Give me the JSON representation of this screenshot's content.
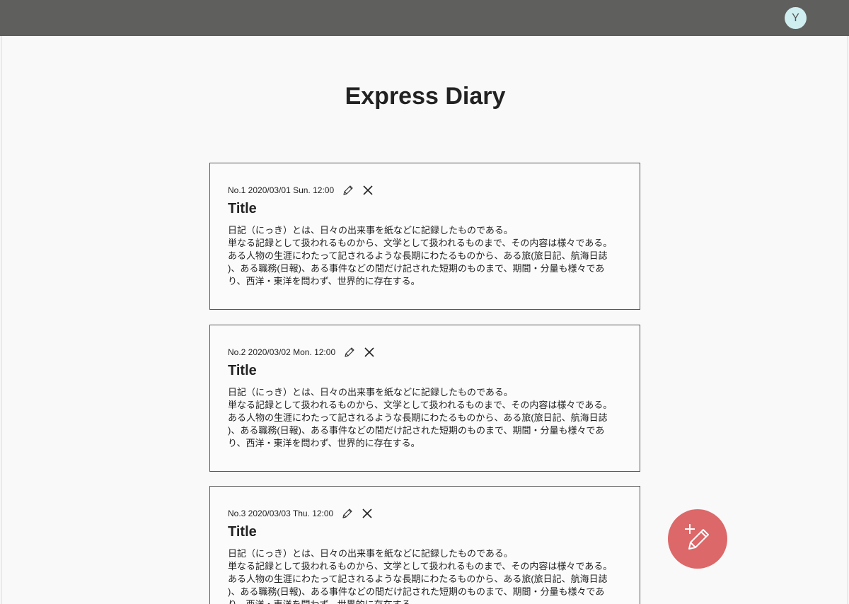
{
  "header": {
    "avatar_initial": "Y"
  },
  "page": {
    "title": "Express Diary"
  },
  "entries": [
    {
      "meta": "No.1 2020/03/01 Sun. 12:00",
      "title": "Title",
      "body": [
        "日記（にっき）とは、日々の出来事を紙などに記録したものである。",
        "単なる記録として扱われるものから、文学として扱われるものまで、その内容は様々である。",
        "ある人物の生涯にわたって記されるような長期にわたるものから、ある旅(旅日記、航海日誌",
        ")、ある職務(日報)、ある事件などの間だけ記された短期のものまで、期間・分量も様々であ",
        "り、西洋・東洋を問わず、世界的に存在する。"
      ]
    },
    {
      "meta": "No.2 2020/03/02 Mon. 12:00",
      "title": "Title",
      "body": [
        "日記（にっき）とは、日々の出来事を紙などに記録したものである。",
        "単なる記録として扱われるものから、文学として扱われるものまで、その内容は様々である。",
        "ある人物の生涯にわたって記されるような長期にわたるものから、ある旅(旅日記、航海日誌",
        ")、ある職務(日報)、ある事件などの間だけ記された短期のものまで、期間・分量も様々であ",
        "り、西洋・東洋を問わず、世界的に存在する。"
      ]
    },
    {
      "meta": "No.3 2020/03/03 Thu. 12:00",
      "title": "Title",
      "body": [
        "日記（にっき）とは、日々の出来事を紙などに記録したものである。",
        "単なる記録として扱われるものから、文学として扱われるものまで、その内容は様々である。",
        "ある人物の生涯にわたって記されるような長期にわたるものから、ある旅(旅日記、航海日誌",
        ")、ある職務(日報)、ある事件などの間だけ記された短期のものまで、期間・分量も様々であ",
        "り、西洋・東洋を問わず、世界的に存在する。"
      ]
    }
  ],
  "icons": {
    "edit": "pencil-icon",
    "delete": "close-icon",
    "fab": "new-entry-icon"
  },
  "colors": {
    "topbar": "#5f5f5d",
    "avatar": "#cfeef0",
    "fab": "#dc6869",
    "page_bg": "#f9f9f9"
  }
}
